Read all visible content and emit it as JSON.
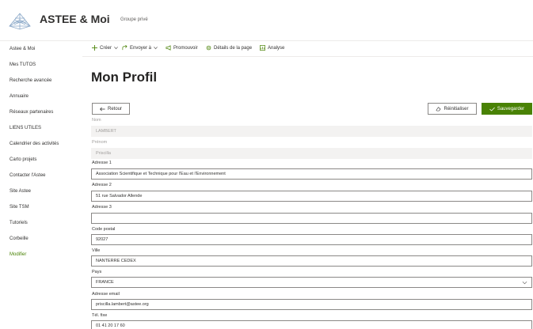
{
  "site": {
    "title": "ASTEE & Moi",
    "subtitle": "Groupe privé"
  },
  "sidebar": {
    "items": [
      {
        "label": "Astee & Moi"
      },
      {
        "label": "Mes TUTOS"
      },
      {
        "label": "Recherche avancée"
      },
      {
        "label": "Annuaire"
      },
      {
        "label": "Réseaux partenaires"
      },
      {
        "label": "LIENS UTILES"
      },
      {
        "label": "Calendrier des activités"
      },
      {
        "label": "Carto projets"
      },
      {
        "label": "Contacter l'Astee"
      },
      {
        "label": "Site Astee"
      },
      {
        "label": "Site TSM"
      },
      {
        "label": "Tutoriels"
      },
      {
        "label": "Corbeille"
      }
    ],
    "edit_label": "Modifier"
  },
  "commandbar": {
    "create": "Créer",
    "send": "Envoyer à",
    "promote": "Promouvoir",
    "page_details": "Détails de la page",
    "analytics": "Analyse"
  },
  "page": {
    "title": "Mon Profil",
    "back_label": "Retour",
    "reset_label": "Réinitialiser",
    "save_label": "Sauvegarder"
  },
  "form": {
    "nom": {
      "label": "Nom",
      "value": "LAMBERT"
    },
    "prenom": {
      "label": "Prénom",
      "value": "Priscilla"
    },
    "adresse1": {
      "label": "Adresse 1",
      "value": "Association Scientifique et Technique pour l'Eau et l'Environnement"
    },
    "adresse2": {
      "label": "Adresse 2",
      "value": "51 rue Salvador Allende"
    },
    "adresse3": {
      "label": "Adresse 3",
      "value": ""
    },
    "code_postal": {
      "label": "Code postal",
      "value": "92027"
    },
    "ville": {
      "label": "Ville",
      "value": "NANTERRE CEDEX"
    },
    "pays": {
      "label": "Pays",
      "value": "FRANCE"
    },
    "email": {
      "label": "Adresse email",
      "value": "priscilla.lambert@astee.org"
    },
    "tel": {
      "label": "Tél. fixe",
      "value": "01 41 20 17 60"
    }
  },
  "colors": {
    "accent": "#498205",
    "border": "#8a8886",
    "disabled_bg": "#f3f2f1"
  }
}
